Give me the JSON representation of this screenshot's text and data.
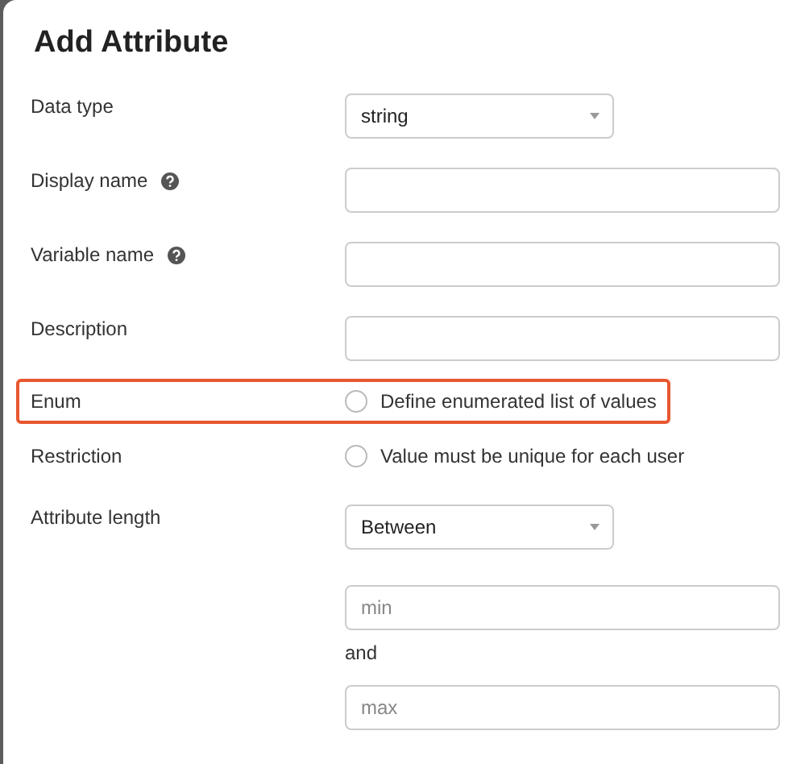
{
  "dialog": {
    "title": "Add Attribute"
  },
  "fields": [
    {
      "kind": "select",
      "label": "Data type",
      "help": false,
      "value": "string"
    },
    {
      "kind": "text",
      "label": "Display name",
      "help": true
    },
    {
      "kind": "text",
      "label": "Variable name",
      "help": true
    },
    {
      "kind": "text",
      "label": "Description",
      "help": false
    },
    {
      "kind": "checkbox",
      "label": "Enum",
      "option": "Define enumerated list of values",
      "checked": false,
      "highlighted": true
    },
    {
      "kind": "checkbox",
      "label": "Restriction",
      "option": "Value must be unique for each user",
      "checked": false,
      "highlighted": false
    },
    {
      "kind": "range",
      "label": "Attribute length",
      "value": "Between",
      "min_placeholder": "min",
      "joiner": "and",
      "max_placeholder": "max"
    }
  ]
}
